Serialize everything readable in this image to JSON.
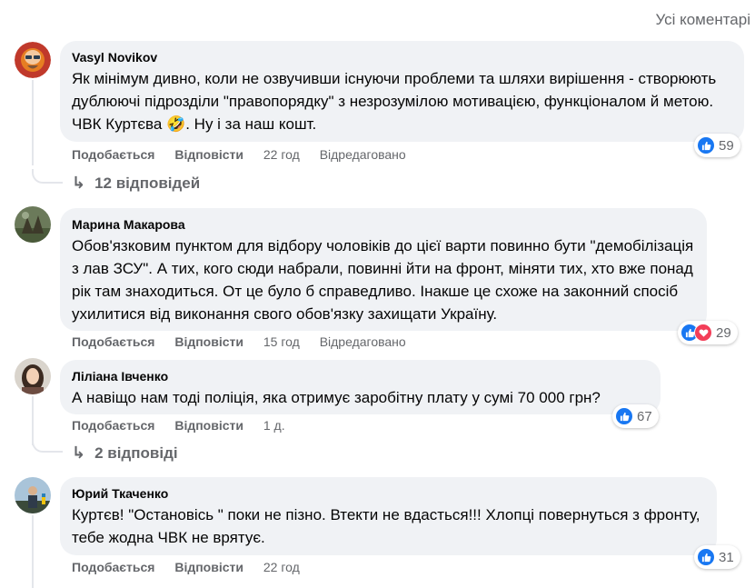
{
  "header": {
    "all_comments": "Усі коментарі"
  },
  "comments": [
    {
      "author": "Vasyl Novikov",
      "text": "Як мінімум дивно, коли не озвучивши існуючи проблеми та шляхи вирішення - створюють дублюючі підрозділи \"правопорядку\" з незрозумілою мотивацією, функціоналом й метою. ЧВК Куртєва 🤣. Ну і за наш кошт.",
      "like_label": "Подобається",
      "reply_label": "Відповісти",
      "time": "22 год",
      "edited": "Відредаговано",
      "reaction_count": "59",
      "replies_label": "12 відповідей"
    },
    {
      "author": "Марина Макарова",
      "text": "Обов'язковим пунктом для відбору чоловіків до цієї варти повинно бути \"демобілізація з лав ЗСУ\". А тих, кого сюди набрали, повинні йти на фронт, міняти тих, хто вже понад рік там знаходиться. От це було б справедливо. Інакше це схоже на законний спосіб ухилитися від виконання свого обов'язку захищати Україну.",
      "like_label": "Подобається",
      "reply_label": "Відповісти",
      "time": "15 год",
      "edited": "Відредаговано",
      "reaction_count": "29"
    },
    {
      "author": "Ліліана Івченко",
      "text": "А навіщо нам тоді поліція, яка отримує заробітну плату у сумі 70 000 грн?",
      "like_label": "Подобається",
      "reply_label": "Відповісти",
      "time": "1 д.",
      "reaction_count": "67",
      "replies_label": "2 відповіді"
    },
    {
      "author": "Юрий Ткаченко",
      "text": "Куртєв! \"Остановісь \" поки не пізно. Втекти не вдасться!!! Хлопці повернуться з фронту, тебе жодна ЧВК не врятує.",
      "like_label": "Подобається",
      "reply_label": "Відповісти",
      "time": "22 год",
      "reaction_count": "31"
    }
  ],
  "colors": {
    "bubble": "#f0f2f5",
    "like": "#1877f2",
    "love": "#f33e58",
    "secondary_text": "#65676b"
  },
  "icons": {
    "like": "thumbs-up-icon",
    "love": "heart-icon",
    "reply_arrow": "reply-arrow-icon"
  }
}
